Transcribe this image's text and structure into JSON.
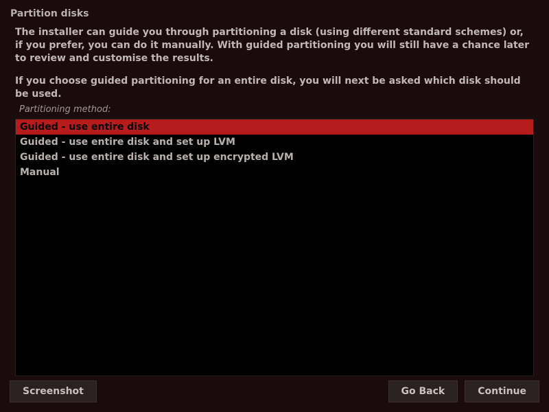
{
  "title": "Partition disks",
  "description": "The installer can guide you through partitioning a disk (using different standard schemes) or, if you prefer, you can do it manually. With guided partitioning you will still have a chance later to review and customise the results.",
  "sub_description": "If you choose guided partitioning for an entire disk, you will next be asked which disk should be used.",
  "field_label": "Partitioning method:",
  "options": [
    {
      "label": "Guided - use entire disk",
      "selected": true
    },
    {
      "label": "Guided - use entire disk and set up LVM",
      "selected": false
    },
    {
      "label": "Guided - use entire disk and set up encrypted LVM",
      "selected": false
    },
    {
      "label": "Manual",
      "selected": false
    }
  ],
  "buttons": {
    "screenshot": "Screenshot",
    "go_back": "Go Back",
    "continue": "Continue"
  }
}
